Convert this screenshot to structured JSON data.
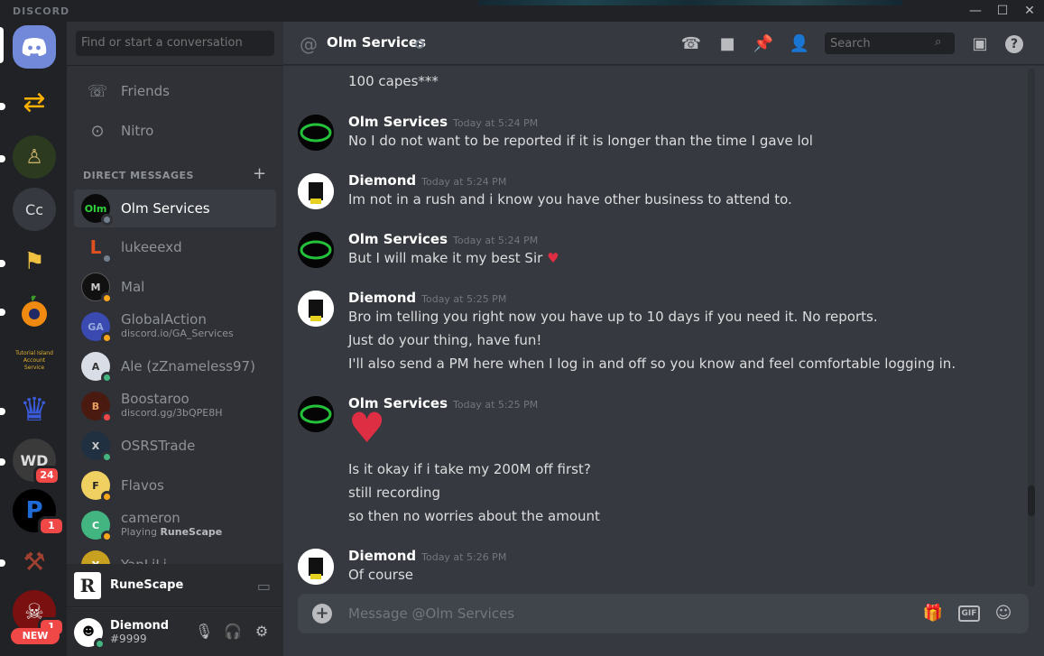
{
  "titlebar": {
    "brand": "DISCORD",
    "minimize": "—",
    "maximize": "☐",
    "close": "✕"
  },
  "servers": [
    {
      "name": "Home",
      "icon": "discord-logo-icon",
      "color": "#7289da"
    },
    {
      "name": "Swap",
      "icon": "arrows-icon",
      "color": "#ffb000"
    },
    {
      "name": "Character",
      "icon": "character-icon",
      "color": "#2c3a20"
    },
    {
      "name": "Cc",
      "label": "Cc",
      "color": "#36393f"
    },
    {
      "name": "Quest",
      "icon": "quest-icon",
      "color": "#202225"
    },
    {
      "name": "Orange",
      "icon": "orange-icon",
      "color": "#202225"
    },
    {
      "name": "Tutorial Island Account Service",
      "label": "Tutorial Island Account Service",
      "color": "#202225"
    },
    {
      "name": "Crown",
      "icon": "crown-icon",
      "color": "#202225"
    },
    {
      "name": "WD",
      "label": "WD",
      "badge": "24",
      "color": "#3a3a3a"
    },
    {
      "name": "P",
      "label": "P",
      "badge": "1",
      "color": "#000"
    },
    {
      "name": "Axe",
      "icon": "axe-icon",
      "color": "#202225"
    },
    {
      "name": "Skull",
      "icon": "skull-icon",
      "badge": "1",
      "new_label": "NEW",
      "color": "#7a1010"
    }
  ],
  "sidebar": {
    "search_placeholder": "Find or start a conversation",
    "friends_label": "Friends",
    "nitro_label": "Nitro",
    "dm_header": "DIRECT MESSAGES",
    "dm_add": "+",
    "dms": [
      {
        "name": "Olm Services",
        "status": "offline",
        "active": true,
        "initials": "Olm"
      },
      {
        "name": "lukeeexd",
        "status": "offline",
        "initials": "L"
      },
      {
        "name": "Mal",
        "status": "idle",
        "initials": "M"
      },
      {
        "name": "GlobalAction",
        "sub": "discord.io/GA_Services",
        "status": "idle",
        "initials": "GA"
      },
      {
        "name": "Ale (zZnameless97)",
        "status": "online",
        "initials": "A"
      },
      {
        "name": "Boostaroo",
        "sub": "discord.gg/3bQPE8H",
        "status": "dnd",
        "initials": "B"
      },
      {
        "name": "OSRSTrade",
        "status": "online",
        "initials": "X"
      },
      {
        "name": "Flavos",
        "status": "idle",
        "initials": "F"
      },
      {
        "name": "cameron",
        "sub_prefix": "Playing ",
        "sub_bold": "RuneScape",
        "status": "idle",
        "initials": "C"
      },
      {
        "name": "YanLiLi",
        "status": "online",
        "initials": "Y"
      }
    ],
    "activity": {
      "label": "RuneScape",
      "logo": "R"
    },
    "user": {
      "name": "Diemond",
      "tag": "#9999"
    }
  },
  "header": {
    "at_symbol": "@",
    "title": "Olm Services",
    "search_placeholder": "Search"
  },
  "messages": {
    "top_fragment": "100 capes***",
    "groups": [
      {
        "author": "Olm Services",
        "time": "Today at 5:24 PM",
        "lines": [
          "No I do not want to be reported if it is longer than the time I gave lol"
        ]
      },
      {
        "author": "Diemond",
        "time": "Today at 5:24 PM",
        "lines": [
          "Im not in a rush and i know you have other business to attend to."
        ]
      },
      {
        "author": "Olm Services",
        "time": "Today at 5:24 PM",
        "lines": [
          "But I will make it my best Sir"
        ]
      },
      {
        "author": "Diemond",
        "time": "Today at 5:25 PM",
        "lines": [
          "Bro im telling you right now you have up to 10 days if you need it. No reports.",
          "Just do your thing, have fun!",
          "I'll also send a PM here when I log  in and off so you know and feel comfortable logging in."
        ]
      },
      {
        "author": "Olm Services",
        "time": "Today at 5:25 PM",
        "lines": [
          "Is it okay if i take my 200M off first?",
          "still recording",
          "so then no worries about the amount"
        ]
      },
      {
        "author": "Diemond",
        "time": "Today at 5:26 PM",
        "lines": [
          "Of course"
        ]
      }
    ]
  },
  "composer": {
    "placeholder": "Message @Olm Services",
    "gif": "GIF"
  },
  "colors": {
    "accent": "#7289da",
    "online": "#43b581",
    "idle": "#faa61a",
    "dnd": "#f04747",
    "offline": "#747f8d",
    "heart": "#dd2e44"
  }
}
